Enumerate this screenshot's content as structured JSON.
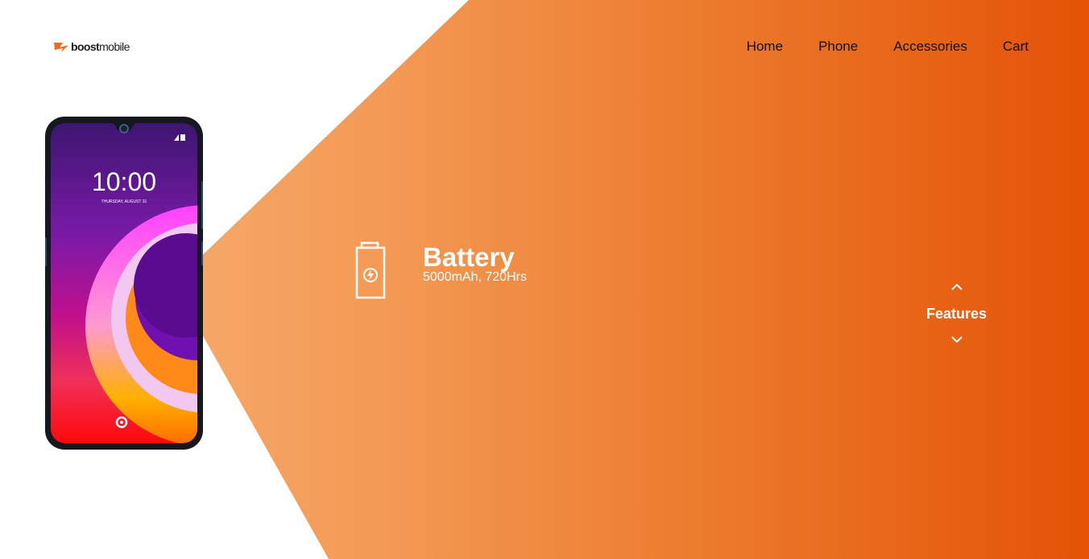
{
  "brand": {
    "logo_bold": "boost",
    "logo_light": "mobile",
    "accent": "#e45306"
  },
  "nav": [
    {
      "label": "Home"
    },
    {
      "label": "Phone"
    },
    {
      "label": "Accessories"
    },
    {
      "label": "Cart"
    }
  ],
  "phone_screen": {
    "time": "10:00",
    "date": "THURSDAY, AUGUST 31"
  },
  "feature": {
    "icon": "battery-charging-icon",
    "title": "Battery",
    "detail": "5000mAh, 720Hrs"
  },
  "features_nav": {
    "label": "Features",
    "up_icon": "chevron-up-icon",
    "down_icon": "chevron-down-icon"
  }
}
